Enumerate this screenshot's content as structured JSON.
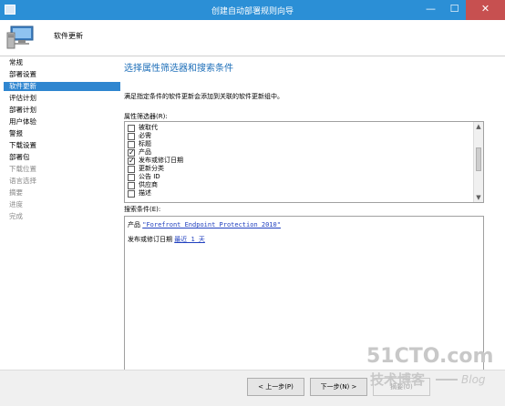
{
  "window": {
    "title": "创建自动部署规则向导",
    "minimize_glyph": "—",
    "maximize_glyph": "☐",
    "close_glyph": "✕"
  },
  "header": {
    "title": "软件更新",
    "icon": "computer-icon"
  },
  "sidebar": {
    "items": [
      {
        "label": "常规",
        "state": "normal"
      },
      {
        "label": "部署设置",
        "state": "normal"
      },
      {
        "label": "软件更新",
        "state": "active"
      },
      {
        "label": "评估计划",
        "state": "normal"
      },
      {
        "label": "部署计划",
        "state": "normal"
      },
      {
        "label": "用户体验",
        "state": "normal"
      },
      {
        "label": "警报",
        "state": "normal"
      },
      {
        "label": "下载设置",
        "state": "normal"
      },
      {
        "label": "部署包",
        "state": "normal"
      },
      {
        "label": "下载位置",
        "state": "disabled"
      },
      {
        "label": "语言选择",
        "state": "disabled"
      },
      {
        "label": "摘要",
        "state": "disabled"
      },
      {
        "label": "进度",
        "state": "disabled"
      },
      {
        "label": "完成",
        "state": "disabled"
      }
    ]
  },
  "main": {
    "heading": "选择属性筛选器和搜索条件",
    "description": "满足指定条件的软件更新会添加到关联的软件更新组中。",
    "filter_label": "属性筛选器(R):",
    "filters": [
      {
        "label": "被取代",
        "checked": false
      },
      {
        "label": "必需",
        "checked": false
      },
      {
        "label": "标题",
        "checked": false
      },
      {
        "label": "产品",
        "checked": true
      },
      {
        "label": "发布或修订日期",
        "checked": true
      },
      {
        "label": "更新分类",
        "checked": false
      },
      {
        "label": "公告 ID",
        "checked": false
      },
      {
        "label": "供应商",
        "checked": false
      },
      {
        "label": "描述",
        "checked": false
      }
    ],
    "criteria_label": "搜索条件(E):",
    "criteria": [
      {
        "field": "产品",
        "value": "\"Forefront Endpoint Protection 2010\""
      },
      {
        "field": "发布或修订日期",
        "value": "最近 1 天"
      }
    ]
  },
  "scroll": {
    "up_glyph": "▲",
    "down_glyph": "▼"
  },
  "footer": {
    "back_label": "< 上一步(P)",
    "next_label": "下一步(N) >",
    "summary_label": "摘要(U)"
  },
  "watermark": {
    "line1": "51CTO.com",
    "line2": "技术博客",
    "line3": "Blog",
    "color": "#c8c8c8"
  },
  "colors": {
    "titlebar": "#2b8fd6",
    "accent": "#2f86d0",
    "heading": "#1e6fb9",
    "link": "#1f3fbf",
    "close": "#c75050"
  }
}
